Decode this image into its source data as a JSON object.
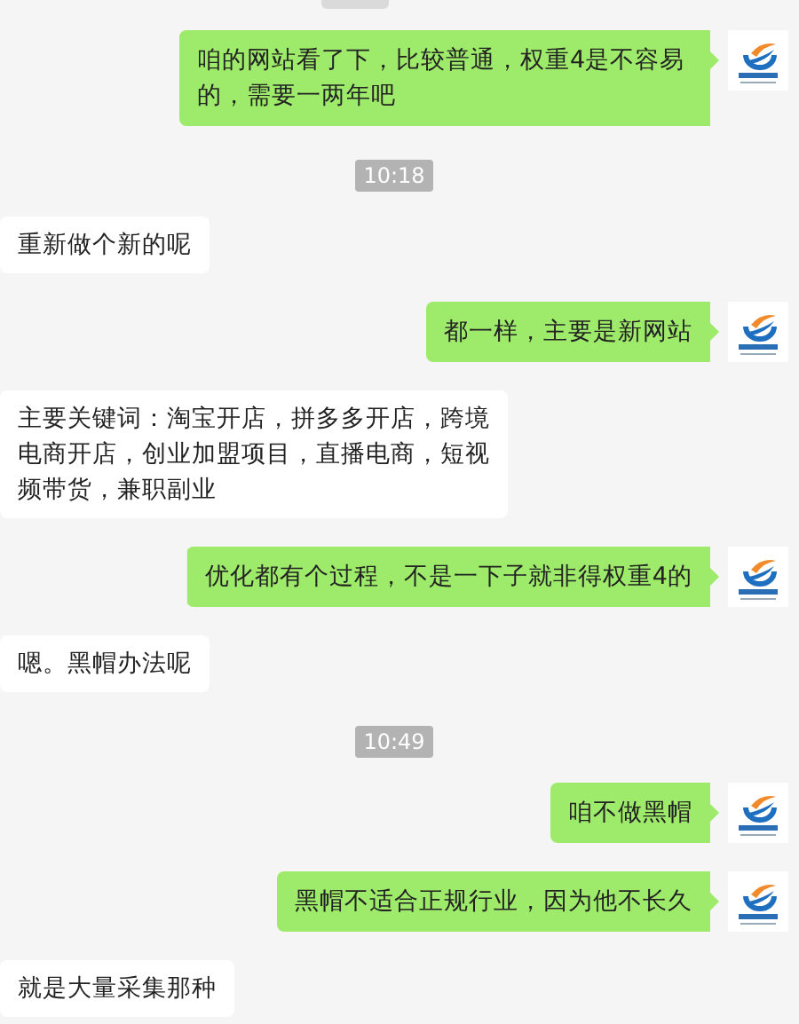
{
  "messages": [
    {
      "kind": "sent",
      "text": "咱的网站看了下，比较普通，权重4是不容易的，需要一两年吧"
    },
    {
      "kind": "time",
      "text": "10:18"
    },
    {
      "kind": "received",
      "text": "重新做个新的呢"
    },
    {
      "kind": "sent",
      "text": "都一样，主要是新网站"
    },
    {
      "kind": "received",
      "text": "主要关键词：淘宝开店，拼多多开店，跨境电商开店，创业加盟项目，直播电商，短视频带货，兼职副业"
    },
    {
      "kind": "sent",
      "text": "优化都有个过程，不是一下子就非得权重4的"
    },
    {
      "kind": "received",
      "text": "嗯。黑帽办法呢"
    },
    {
      "kind": "time",
      "text": "10:49"
    },
    {
      "kind": "sent",
      "text": "咱不做黑帽"
    },
    {
      "kind": "sent",
      "text": "黑帽不适合正规行业，因为他不长久"
    },
    {
      "kind": "received",
      "text": "就是大量采集那种"
    }
  ]
}
